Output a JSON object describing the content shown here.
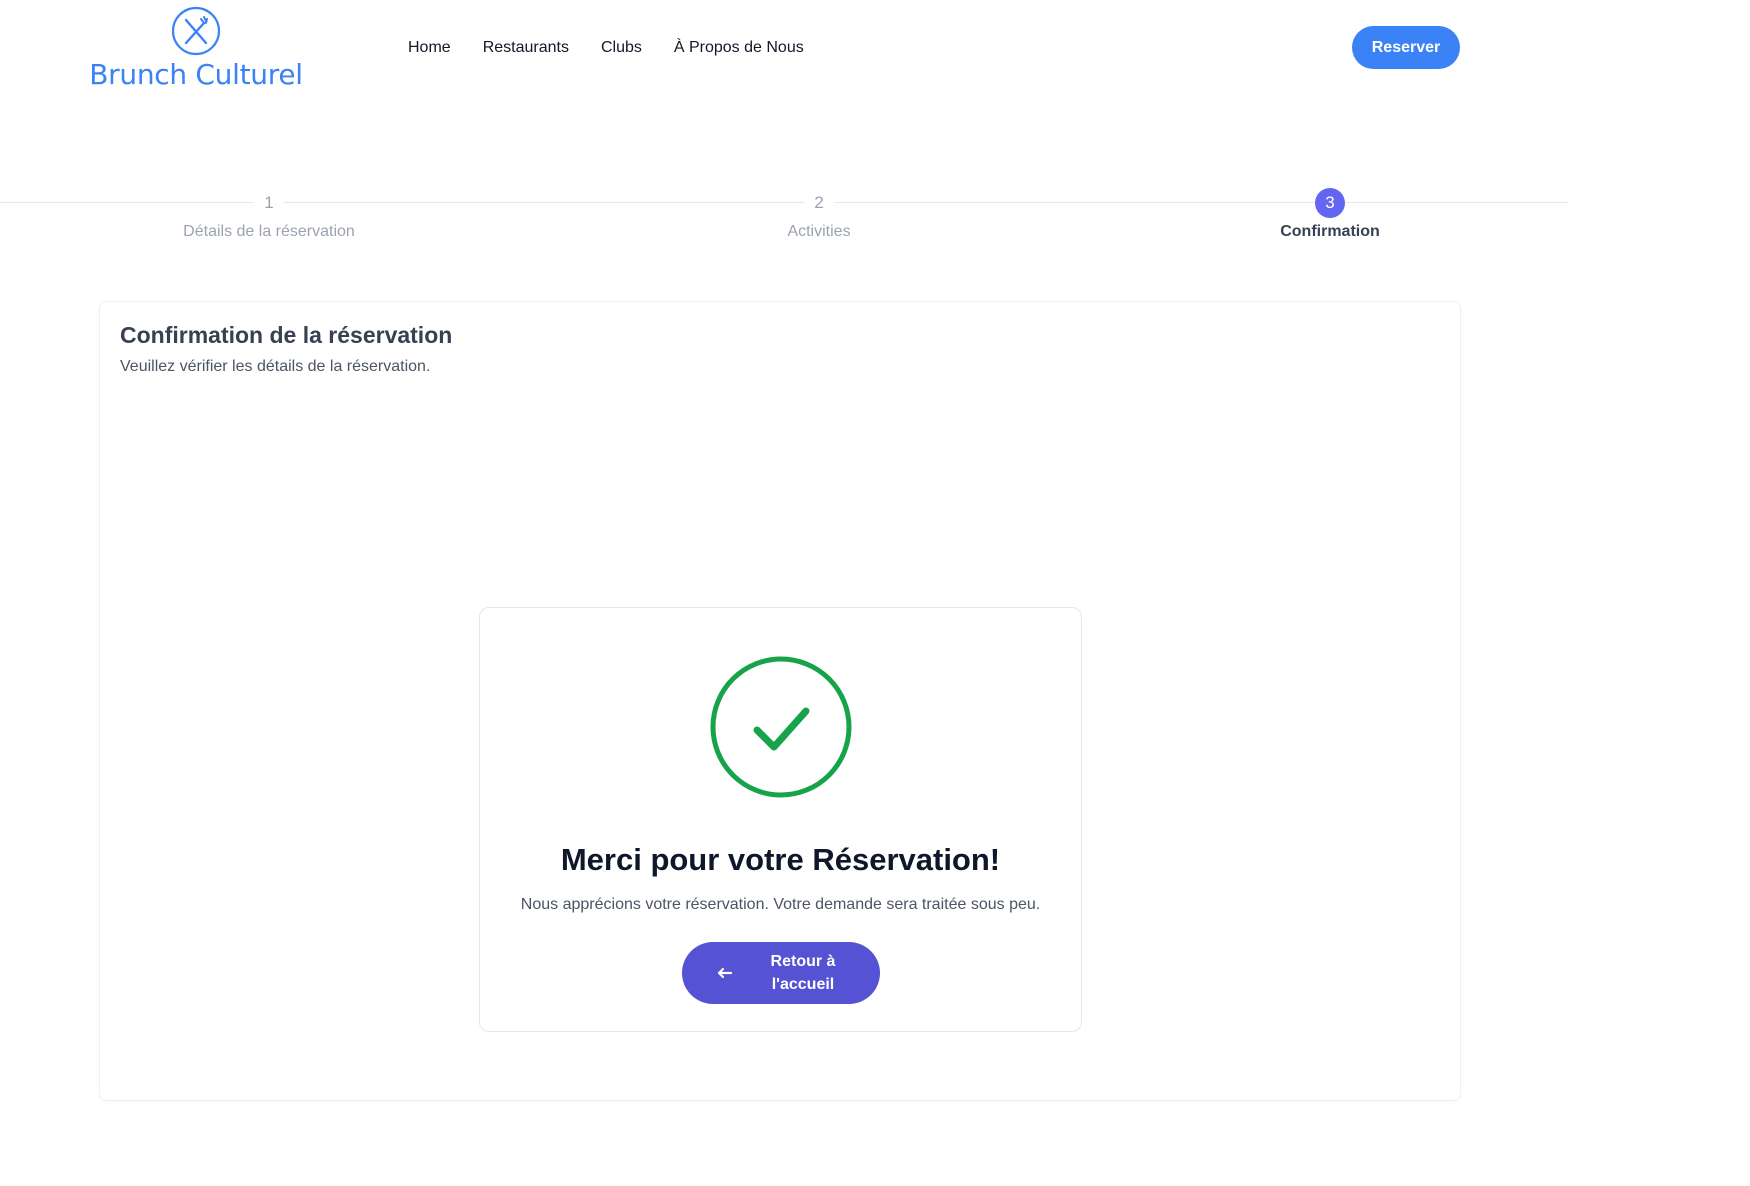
{
  "brand": {
    "name": "Brunch Culturel",
    "icon": "fork-knife-icon",
    "color": "#3b82f6"
  },
  "nav": {
    "items": [
      {
        "label": "Home"
      },
      {
        "label": "Restaurants"
      },
      {
        "label": "Clubs"
      },
      {
        "label": "À Propos de Nous"
      }
    ],
    "cta_label": "Reserver"
  },
  "stepper": {
    "steps": [
      {
        "number": "1",
        "label": "Détails de la réservation",
        "state": "inactive"
      },
      {
        "number": "2",
        "label": "Activities",
        "state": "inactive"
      },
      {
        "number": "3",
        "label": "Confirmation",
        "state": "active"
      }
    ],
    "active_color": "#6366f1"
  },
  "card": {
    "title": "Confirmation de la réservation",
    "subtitle": "Veuillez vérifier les détails de la réservation."
  },
  "success": {
    "icon": "check-circle-icon",
    "icon_color": "#16a34a",
    "title": "Merci pour votre Réservation!",
    "message": "Nous apprécions votre réservation. Votre demande sera traitée sous peu.",
    "button_label": "Retour à l'accueil",
    "button_icon": "arrow-left-icon",
    "button_color": "#5553d3"
  }
}
